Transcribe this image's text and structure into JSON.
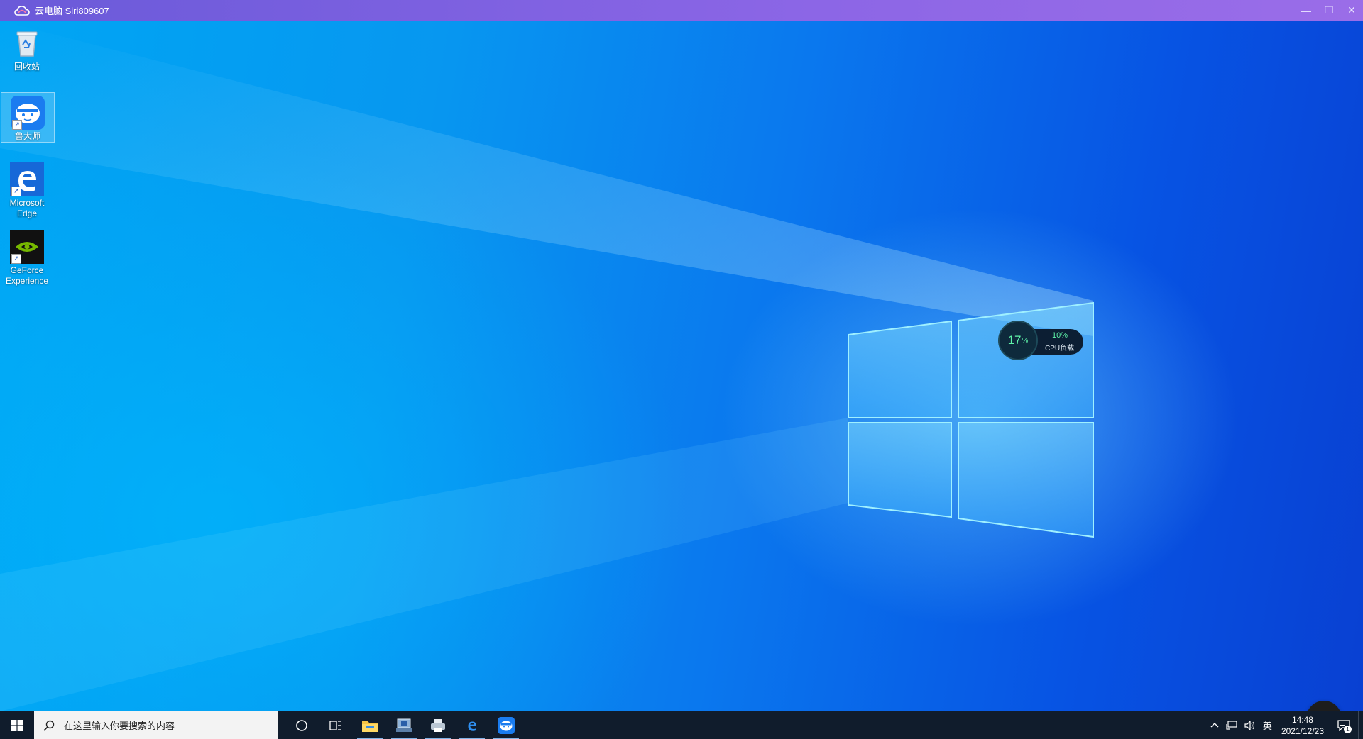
{
  "window": {
    "title": "云电脑 Siri809607",
    "controls": [
      "minimize-icon",
      "restore-icon",
      "close-icon"
    ],
    "accent": "#8c66e6"
  },
  "desktop": {
    "icons": [
      {
        "label": "回收站",
        "icon": "recycle-bin-icon",
        "shortcut": false
      },
      {
        "label": "鲁大师",
        "icon": "ludashi-icon",
        "shortcut": true,
        "selected": true
      },
      {
        "label": "Microsoft Edge",
        "icon": "edge-icon",
        "shortcut": true
      },
      {
        "label": "GeForce Experience",
        "icon": "nvidia-icon",
        "shortcut": true
      }
    ]
  },
  "cpu_widget": {
    "gauge_value": "17",
    "gauge_unit": "%",
    "load_value": "10%",
    "load_label": "CPU负载"
  },
  "taskbar": {
    "search_placeholder": "在这里输入你要搜索的内容",
    "pinned": [
      "cortana-icon",
      "task-view-icon",
      "file-explorer-icon",
      "network-app-icon",
      "printer-app-icon",
      "edge-icon",
      "ludashi-icon"
    ],
    "tray": {
      "ime": "英",
      "time": "14:48",
      "date": "2021/12/23",
      "notification_count": "1"
    }
  }
}
